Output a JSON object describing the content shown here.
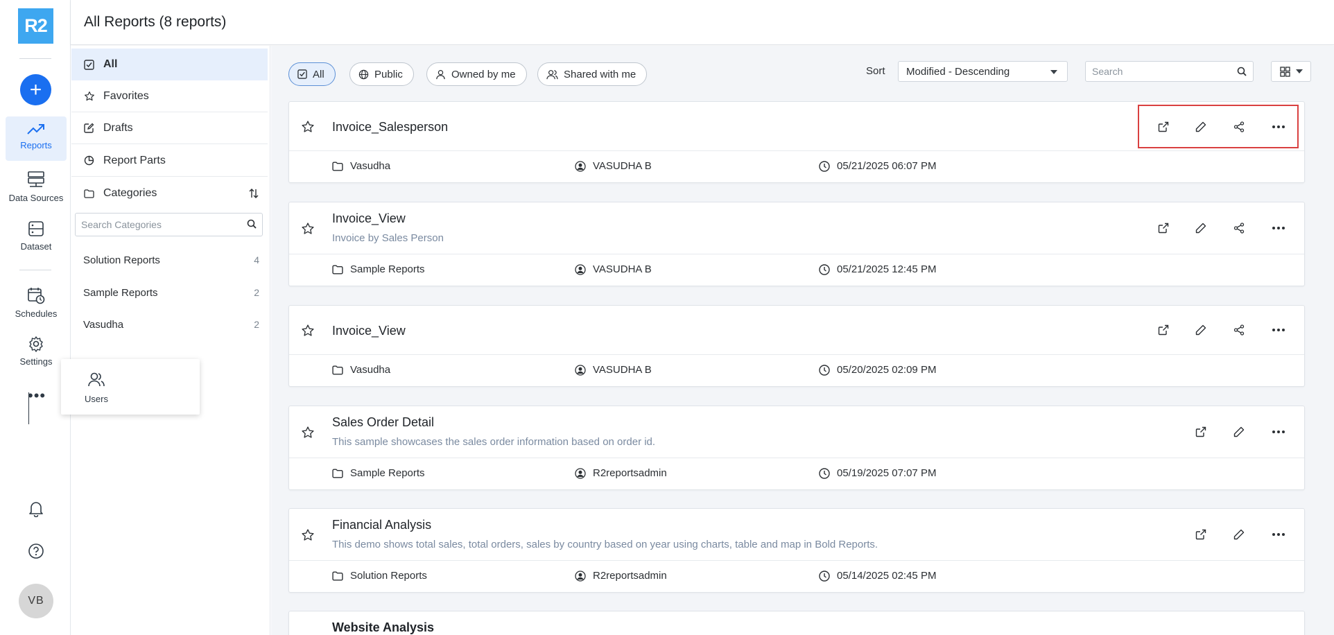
{
  "app": {
    "logo_text": "R2",
    "brand_color": "#3ea7f0",
    "accent_color": "#1a6ff0"
  },
  "rail": {
    "add_label": "+",
    "items": [
      {
        "label": "Reports",
        "icon": "trend-icon",
        "active": true
      },
      {
        "label": "Data Sources",
        "icon": "server-icon"
      },
      {
        "label": "Dataset",
        "icon": "dataset-icon"
      },
      {
        "label": "Schedules",
        "icon": "calendar-clock-icon"
      },
      {
        "label": "Settings",
        "icon": "gear-icon"
      }
    ],
    "more_label": "•••",
    "avatar_initials": "VB"
  },
  "popup": {
    "label": "Users",
    "icon": "users-icon"
  },
  "header": {
    "title": "All Reports (8 reports)"
  },
  "sidebar": {
    "items": [
      {
        "label": "All",
        "icon": "check-square-icon",
        "active": true
      },
      {
        "label": "Favorites",
        "icon": "star-icon"
      },
      {
        "label": "Drafts",
        "icon": "edit-square-icon"
      },
      {
        "label": "Report Parts",
        "icon": "pie-icon"
      },
      {
        "label": "Categories",
        "icon": "folder-icon"
      }
    ],
    "category_search_placeholder": "Search Categories",
    "categories": [
      {
        "name": "Solution Reports",
        "count": "4"
      },
      {
        "name": "Sample Reports",
        "count": "2"
      },
      {
        "name": "Vasudha",
        "count": "2"
      }
    ]
  },
  "filters": {
    "chips": [
      {
        "label": "All",
        "active": true
      },
      {
        "label": "Public"
      },
      {
        "label": "Owned by me"
      },
      {
        "label": "Shared with me"
      }
    ],
    "sort_label": "Sort",
    "sort_value": "Modified - Descending",
    "search_placeholder": "Search"
  },
  "reports": [
    {
      "name": "Invoice_Salesperson",
      "description": "",
      "category": "Vasudha",
      "owner": "VASUDHA B",
      "modified": "05/21/2025 06:07 PM",
      "shareable": true
    },
    {
      "name": "Invoice_View",
      "description": "Invoice by Sales Person",
      "category": "Sample Reports",
      "owner": "VASUDHA B",
      "modified": "05/21/2025 12:45 PM",
      "shareable": true
    },
    {
      "name": "Invoice_View",
      "description": "",
      "category": "Vasudha",
      "owner": "VASUDHA B",
      "modified": "05/20/2025 02:09 PM",
      "shareable": true
    },
    {
      "name": "Sales Order Detail",
      "description": "This sample showcases the sales order information based on order id.",
      "category": "Sample Reports",
      "owner": "R2reportsadmin",
      "modified": "05/19/2025 07:07 PM",
      "shareable": false
    },
    {
      "name": "Financial Analysis",
      "description": "This demo shows total sales, total orders, sales by country based on year using charts, table and map in Bold Reports.",
      "category": "Solution Reports",
      "owner": "R2reportsadmin",
      "modified": "05/14/2025 02:45 PM",
      "shareable": false
    },
    {
      "name": "Website Analysis",
      "description": "",
      "category": "",
      "owner": "",
      "modified": "",
      "shareable": false
    }
  ]
}
